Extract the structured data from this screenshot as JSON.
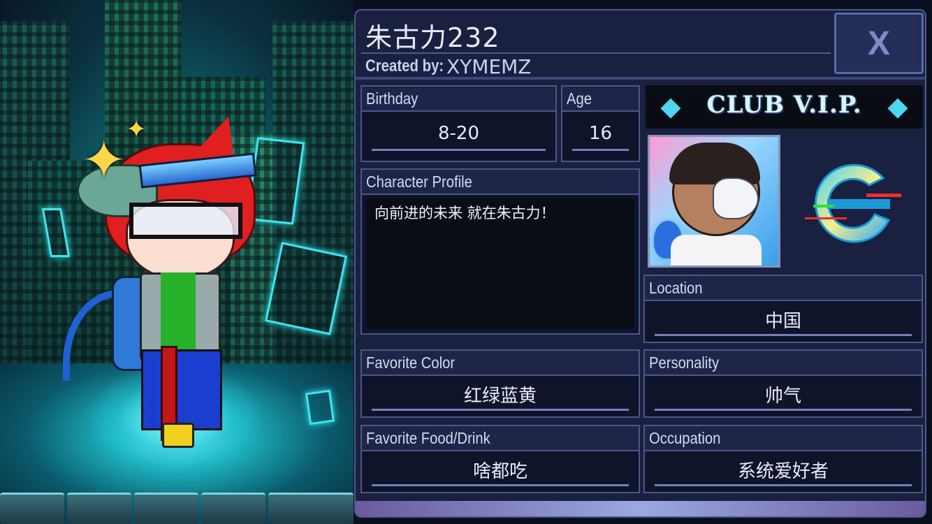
{
  "character": {
    "name": "朱古力232",
    "created_by_label": "Created by:",
    "creator": "XYMEMZ"
  },
  "close_button": {
    "label": "X"
  },
  "fields": {
    "birthday": {
      "label": "Birthday",
      "value": "8-20"
    },
    "age": {
      "label": "Age",
      "value": "16"
    },
    "profile": {
      "label": "Character Profile",
      "value": "向前进的未来 就在朱古力！"
    },
    "location": {
      "label": "Location",
      "value": "中国"
    },
    "favorite_color": {
      "label": "Favorite Color",
      "value": "红绿蓝黄"
    },
    "personality": {
      "label": "Personality",
      "value": "帅气"
    },
    "favorite_food": {
      "label": "Favorite Food/Drink",
      "value": "啥都吃"
    },
    "occupation": {
      "label": "Occupation",
      "value": "系统爱好者"
    }
  },
  "vip": {
    "text": "CLUB V.I.P."
  },
  "colors": {
    "panel_bg": "#1a2140",
    "field_bg": "#10142a",
    "border": "#4a5787",
    "text": "#e8ecff",
    "hair": "#e02020",
    "accent": "#36e3ee"
  }
}
